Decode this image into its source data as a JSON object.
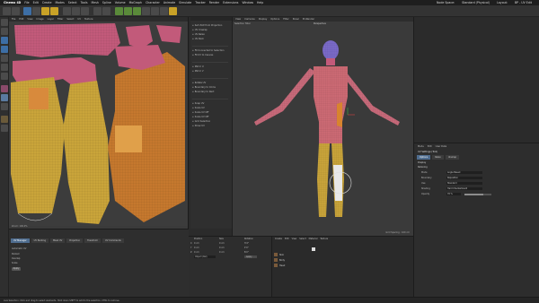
{
  "menubar": {
    "app": "Cinema 4D",
    "items": [
      "File",
      "Edit",
      "Create",
      "Modes",
      "Select",
      "Tools",
      "Mesh",
      "Spline",
      "Volume",
      "MoGraph",
      "Character",
      "Animate",
      "Simulate",
      "Tracker",
      "Render",
      "Extensions",
      "Window",
      "Help"
    ],
    "right": [
      "Node Space:",
      "Standard (Physical)",
      "Layout:",
      "BP - UV Edit"
    ]
  },
  "uv_editor": {
    "menu": [
      "File",
      "Edit",
      "View",
      "Image",
      "Layer",
      "Filter",
      "Select",
      "UV",
      "Texture"
    ],
    "footer": "Zoom: 100.0%"
  },
  "tool_panel": {
    "items": [
      "Set UVW from Projection",
      "UV Unwrap",
      "UV Relax",
      "UV Pack",
      "Fit Connected to Selection",
      "Fit UV to Canvas",
      "Mirror U",
      "Mirror V",
      "Rotate UV",
      "Boundary to Circle",
      "Boundary to Rect",
      "Snap UV",
      "Scale UV",
      "Scale UV Off",
      "Scale UV Off",
      "Grid Selection",
      "Show UV"
    ]
  },
  "uv_attributes": {
    "tabs": [
      "UV Manager",
      "UV Packing",
      "Mask UV",
      "Projection",
      "Transform",
      "UV Commands"
    ],
    "rows": [
      "Automatic UV",
      "Packed",
      "Overlap",
      "Scale",
      "Apply"
    ]
  },
  "viewport": {
    "menu": [
      "View",
      "Cameras",
      "Display",
      "Options",
      "Filter",
      "Panel",
      "ProRender"
    ],
    "title": "Perspective",
    "label": "Selection Total",
    "footer": "Grid Spacing : 100 cm"
  },
  "coords": {
    "headers": [
      "Position",
      "Size",
      "Rotation"
    ],
    "rows": [
      {
        "axis": "X",
        "pos": "0 cm",
        "size": "0 cm",
        "rot": "H 0°"
      },
      {
        "axis": "Y",
        "pos": "0 cm",
        "size": "0 cm",
        "rot": "P 0°"
      },
      {
        "axis": "Z",
        "pos": "0 cm",
        "size": "0 cm",
        "rot": "B 0°"
      }
    ],
    "mode": "Object (Rel)",
    "apply": "Apply"
  },
  "materials": {
    "menu": [
      "Create",
      "Edit",
      "View",
      "Select",
      "Material",
      "Texture"
    ],
    "objects": [
      "Skin",
      "Body",
      "Head"
    ]
  },
  "attributes": {
    "menu": [
      "Mode",
      "Edit",
      "User Data"
    ],
    "title": "UV Settings (Tool)",
    "tabs": [
      "Options",
      "Relax",
      "Unwrap"
    ],
    "sections": [
      {
        "label": "Display"
      },
      {
        "label": "Relaxing"
      }
    ],
    "fields": [
      {
        "label": "Mode",
        "value": "Angle Based"
      },
      {
        "label": "Boundary",
        "value": "Reposition"
      },
      {
        "label": "Use",
        "value": "Standard"
      },
      {
        "label": "Shading",
        "value": "Hard Checkerboard"
      },
      {
        "label": "Opacity",
        "value": "70 %"
      }
    ]
  },
  "status": {
    "text": "Live Selection: Click and drag to select elements. Hold down SHIFT to add to the selection, CTRL to remove."
  },
  "colors": {
    "accent_blue": "#4f6d8f",
    "uv_pink": "#c25a7a",
    "uv_orange": "#c5782e",
    "uv_yellow": "#c9a43a",
    "uv_purple": "#6a4a9a",
    "uv_blue": "#5a6fb0"
  }
}
